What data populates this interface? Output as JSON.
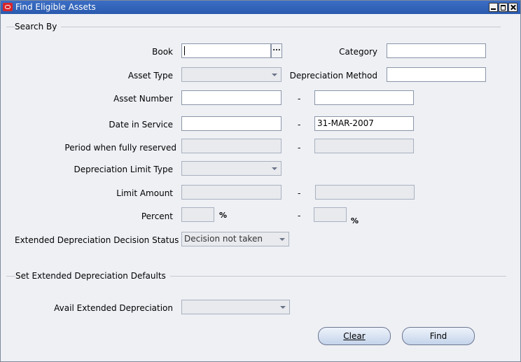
{
  "window": {
    "title": "Find Eligible Assets"
  },
  "search_by": {
    "heading": "Search By",
    "book_label": "Book",
    "book_value": "",
    "lov_glyph": "...",
    "category_label": "Category",
    "category_value": "",
    "asset_type_label": "Asset Type",
    "asset_type_value": "",
    "depreciation_method_label": "Depreciation Method",
    "depreciation_method_value": "",
    "asset_number_label": "Asset Number",
    "asset_number_from": "",
    "asset_number_to": "",
    "date_in_service_label": "Date in Service",
    "date_in_service_from": "",
    "date_in_service_to": "31-MAR-2007",
    "period_fully_reserved_label": "Period when fully reserved",
    "depreciation_limit_type_label": "Depreciation Limit Type",
    "limit_amount_label": "Limit Amount",
    "percent_label": "Percent",
    "percent_symbol": "%",
    "range_separator": "-",
    "ext_dep_decision_label": "Extended Depreciation Decision Status",
    "ext_dep_decision_value": "Decision not taken"
  },
  "defaults": {
    "heading": "Set Extended Depreciation Defaults",
    "avail_ext_dep_label": "Avail Extended Depreciation",
    "avail_ext_dep_value": ""
  },
  "buttons": {
    "clear_label": "Clear",
    "find_label": "Find"
  }
}
